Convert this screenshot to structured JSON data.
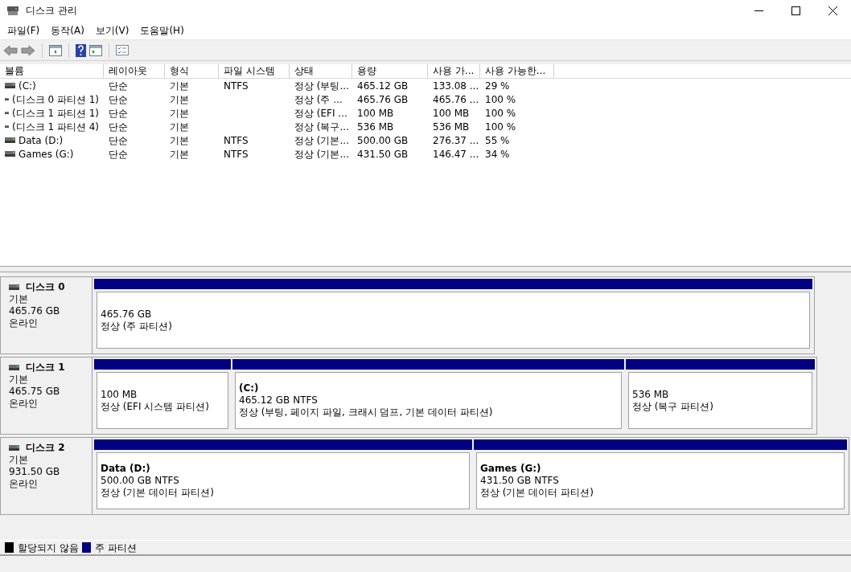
{
  "window": {
    "title": "디스크 관리"
  },
  "menu": [
    "파일(F)",
    "동작(A)",
    "보기(V)",
    "도움말(H)"
  ],
  "table": {
    "columns": [
      "볼륨",
      "레이아웃",
      "형식",
      "파일 시스템",
      "상태",
      "용량",
      "사용 가...",
      "사용 가능한..."
    ],
    "rows": [
      [
        "(C:)",
        "단순",
        "기본",
        "NTFS",
        "정상 (부팅...",
        "465.12 GB",
        "133.08 ...",
        "29 %"
      ],
      [
        "(디스크 0 파티션 1)",
        "단순",
        "기본",
        "",
        "정상 (주 ...",
        "465.76 GB",
        "465.76 ...",
        "100 %"
      ],
      [
        "(디스크 1 파티션 1)",
        "단순",
        "기본",
        "",
        "정상 (EFI ...",
        "100 MB",
        "100 MB",
        "100 %"
      ],
      [
        "(디스크 1 파티션 4)",
        "단순",
        "기본",
        "",
        "정상 (복구...",
        "536 MB",
        "536 MB",
        "100 %"
      ],
      [
        "Data (D:)",
        "단순",
        "기본",
        "NTFS",
        "정상 (기본...",
        "500.00 GB",
        "276.37 ...",
        "55 %"
      ],
      [
        "Games (G:)",
        "단순",
        "기본",
        "NTFS",
        "정상 (기본...",
        "431.50 GB",
        "146.47 ...",
        "34 %"
      ]
    ]
  },
  "disks": [
    {
      "name": "디스크 0",
      "type": "기본",
      "size": "465.76 GB",
      "status": "온라인",
      "partitions": [
        {
          "size": "465.76 GB",
          "status": "정상 (주 파티션)"
        }
      ]
    },
    {
      "name": "디스크 1",
      "type": "기본",
      "size": "465.75 GB",
      "status": "온라인",
      "partitions": [
        {
          "size": "100 MB",
          "status": "정상 (EFI 시스템 파티션)"
        },
        {
          "title": "(C:)",
          "size": "465.12 GB NTFS",
          "status": "정상 (부팅, 페이지 파일, 크래시 덤프, 기본 데이터 파티션)"
        },
        {
          "size": "536 MB",
          "status": "정상 (복구 파티션)"
        }
      ]
    },
    {
      "name": "디스크 2",
      "type": "기본",
      "size": "931.50 GB",
      "status": "온라인",
      "partitions": [
        {
          "title": "Data  (D:)",
          "size": "500.00 GB NTFS",
          "status": "정상 (기본 데이터 파티션)"
        },
        {
          "title": "Games  (G:)",
          "size": "431.50 GB NTFS",
          "status": "정상 (기본 데이터 파티션)"
        }
      ]
    }
  ],
  "legend": [
    {
      "label": "할당되지 않음",
      "color": "#000000"
    },
    {
      "label": "주 파티션",
      "color": "#000080"
    }
  ]
}
